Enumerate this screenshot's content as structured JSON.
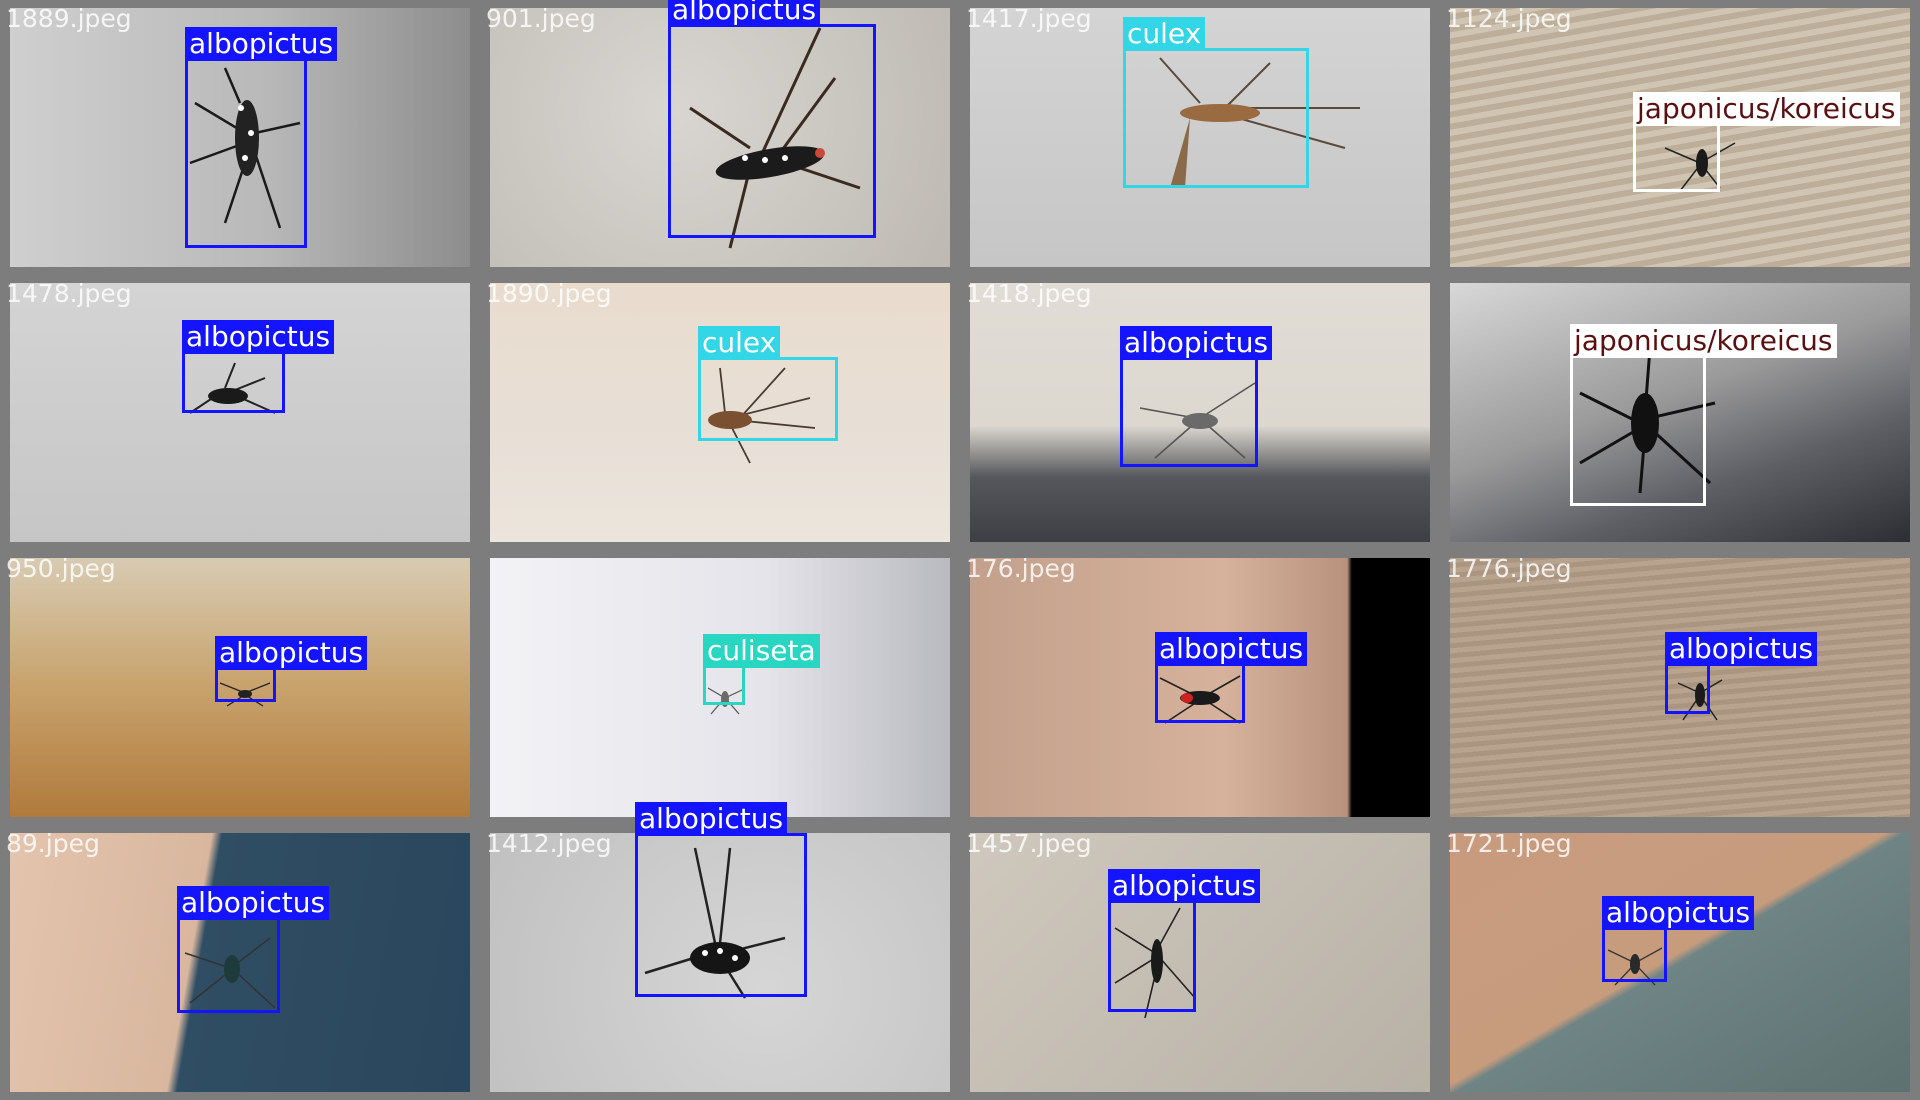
{
  "tiles": [
    {
      "filename": "1889.jpeg",
      "label": "albopictus",
      "label_color": "#1414ff",
      "label_text_color": "#ffffff"
    },
    {
      "filename": "901.jpeg",
      "label": "albopictus",
      "label_color": "#1414ff",
      "label_text_color": "#ffffff"
    },
    {
      "filename": "1417.jpeg",
      "label": "culex",
      "label_color": "#33d6e6",
      "label_text_color": "#ffffff"
    },
    {
      "filename": "1124.jpeg",
      "label": "japonicus/koreicus",
      "label_color": "#ffffff",
      "label_text_color": "#5a1010"
    },
    {
      "filename": "1478.jpeg",
      "label": "albopictus",
      "label_color": "#1414ff",
      "label_text_color": "#ffffff"
    },
    {
      "filename": "1890.jpeg",
      "label": "culex",
      "label_color": "#33d6e6",
      "label_text_color": "#ffffff"
    },
    {
      "filename": "1418.jpeg",
      "label": "albopictus",
      "label_color": "#1414ff",
      "label_text_color": "#ffffff"
    },
    {
      "filename": "",
      "label": "japonicus/koreicus",
      "label_color": "#ffffff",
      "label_text_color": "#5a1010"
    },
    {
      "filename": "950.jpeg",
      "label": "albopictus",
      "label_color": "#1414ff",
      "label_text_color": "#ffffff"
    },
    {
      "filename": "",
      "label": "culiseta",
      "label_color": "#29d6c2",
      "label_text_color": "#ffffff"
    },
    {
      "filename": "176.jpeg",
      "label": "albopictus",
      "label_color": "#1414ff",
      "label_text_color": "#ffffff"
    },
    {
      "filename": "1776.jpeg",
      "label": "albopictus",
      "label_color": "#1414ff",
      "label_text_color": "#ffffff"
    },
    {
      "filename": "89.jpeg",
      "label": "albopictus",
      "label_color": "#1414ff",
      "label_text_color": "#ffffff"
    },
    {
      "filename": "1412.jpeg",
      "label": "albopictus",
      "label_color": "#1414ff",
      "label_text_color": "#ffffff"
    },
    {
      "filename": "1457.jpeg",
      "label": "albopictus",
      "label_color": "#1414ff",
      "label_text_color": "#ffffff"
    },
    {
      "filename": "1721.jpeg",
      "label": "albopictus",
      "label_color": "#1414ff",
      "label_text_color": "#ffffff"
    }
  ]
}
